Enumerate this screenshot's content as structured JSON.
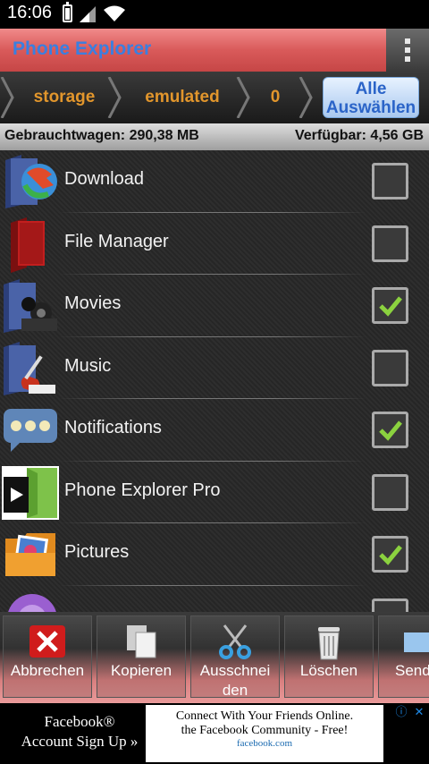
{
  "status_bar": {
    "time": "16:06"
  },
  "app_bar": {
    "title": "Phone Explorer"
  },
  "breadcrumb": {
    "items": [
      "storage",
      "emulated",
      "0"
    ],
    "select_all": "Alle Auswählen"
  },
  "storage": {
    "used": "Gebrauchtwagen: 290,38 MB",
    "free": "Verfügbar: 4,56 GB"
  },
  "files": [
    {
      "name": "Download",
      "checked": false,
      "icon": "download-folder-icon"
    },
    {
      "name": "File Manager",
      "checked": false,
      "icon": "red-folder-icon"
    },
    {
      "name": "Movies",
      "checked": true,
      "icon": "movies-folder-icon"
    },
    {
      "name": "Music",
      "checked": false,
      "icon": "music-folder-icon"
    },
    {
      "name": "Notifications",
      "checked": true,
      "icon": "speech-bubble-icon"
    },
    {
      "name": "Phone Explorer Pro",
      "checked": false,
      "icon": "video-player-icon"
    },
    {
      "name": "Pictures",
      "checked": true,
      "icon": "pictures-folder-icon"
    }
  ],
  "toolbar": {
    "cancel": "Abbrechen",
    "copy": "Kopieren",
    "cut_line1": "Ausschnei",
    "cut_line2": "den",
    "delete": "Löschen",
    "send": "Send"
  },
  "ad": {
    "left_line1": "Facebook®",
    "left_line2": "Account Sign Up »",
    "right_line1": "Connect With Your Friends Online.",
    "right_line2": "the Facebook Community - Free!",
    "right_line3": "facebook.com"
  },
  "colors": {
    "accent_blue": "#3a7fe0",
    "crumb_orange": "#e2962c",
    "check_green": "#8bd23f",
    "appbar_red": "#d95a5a"
  }
}
